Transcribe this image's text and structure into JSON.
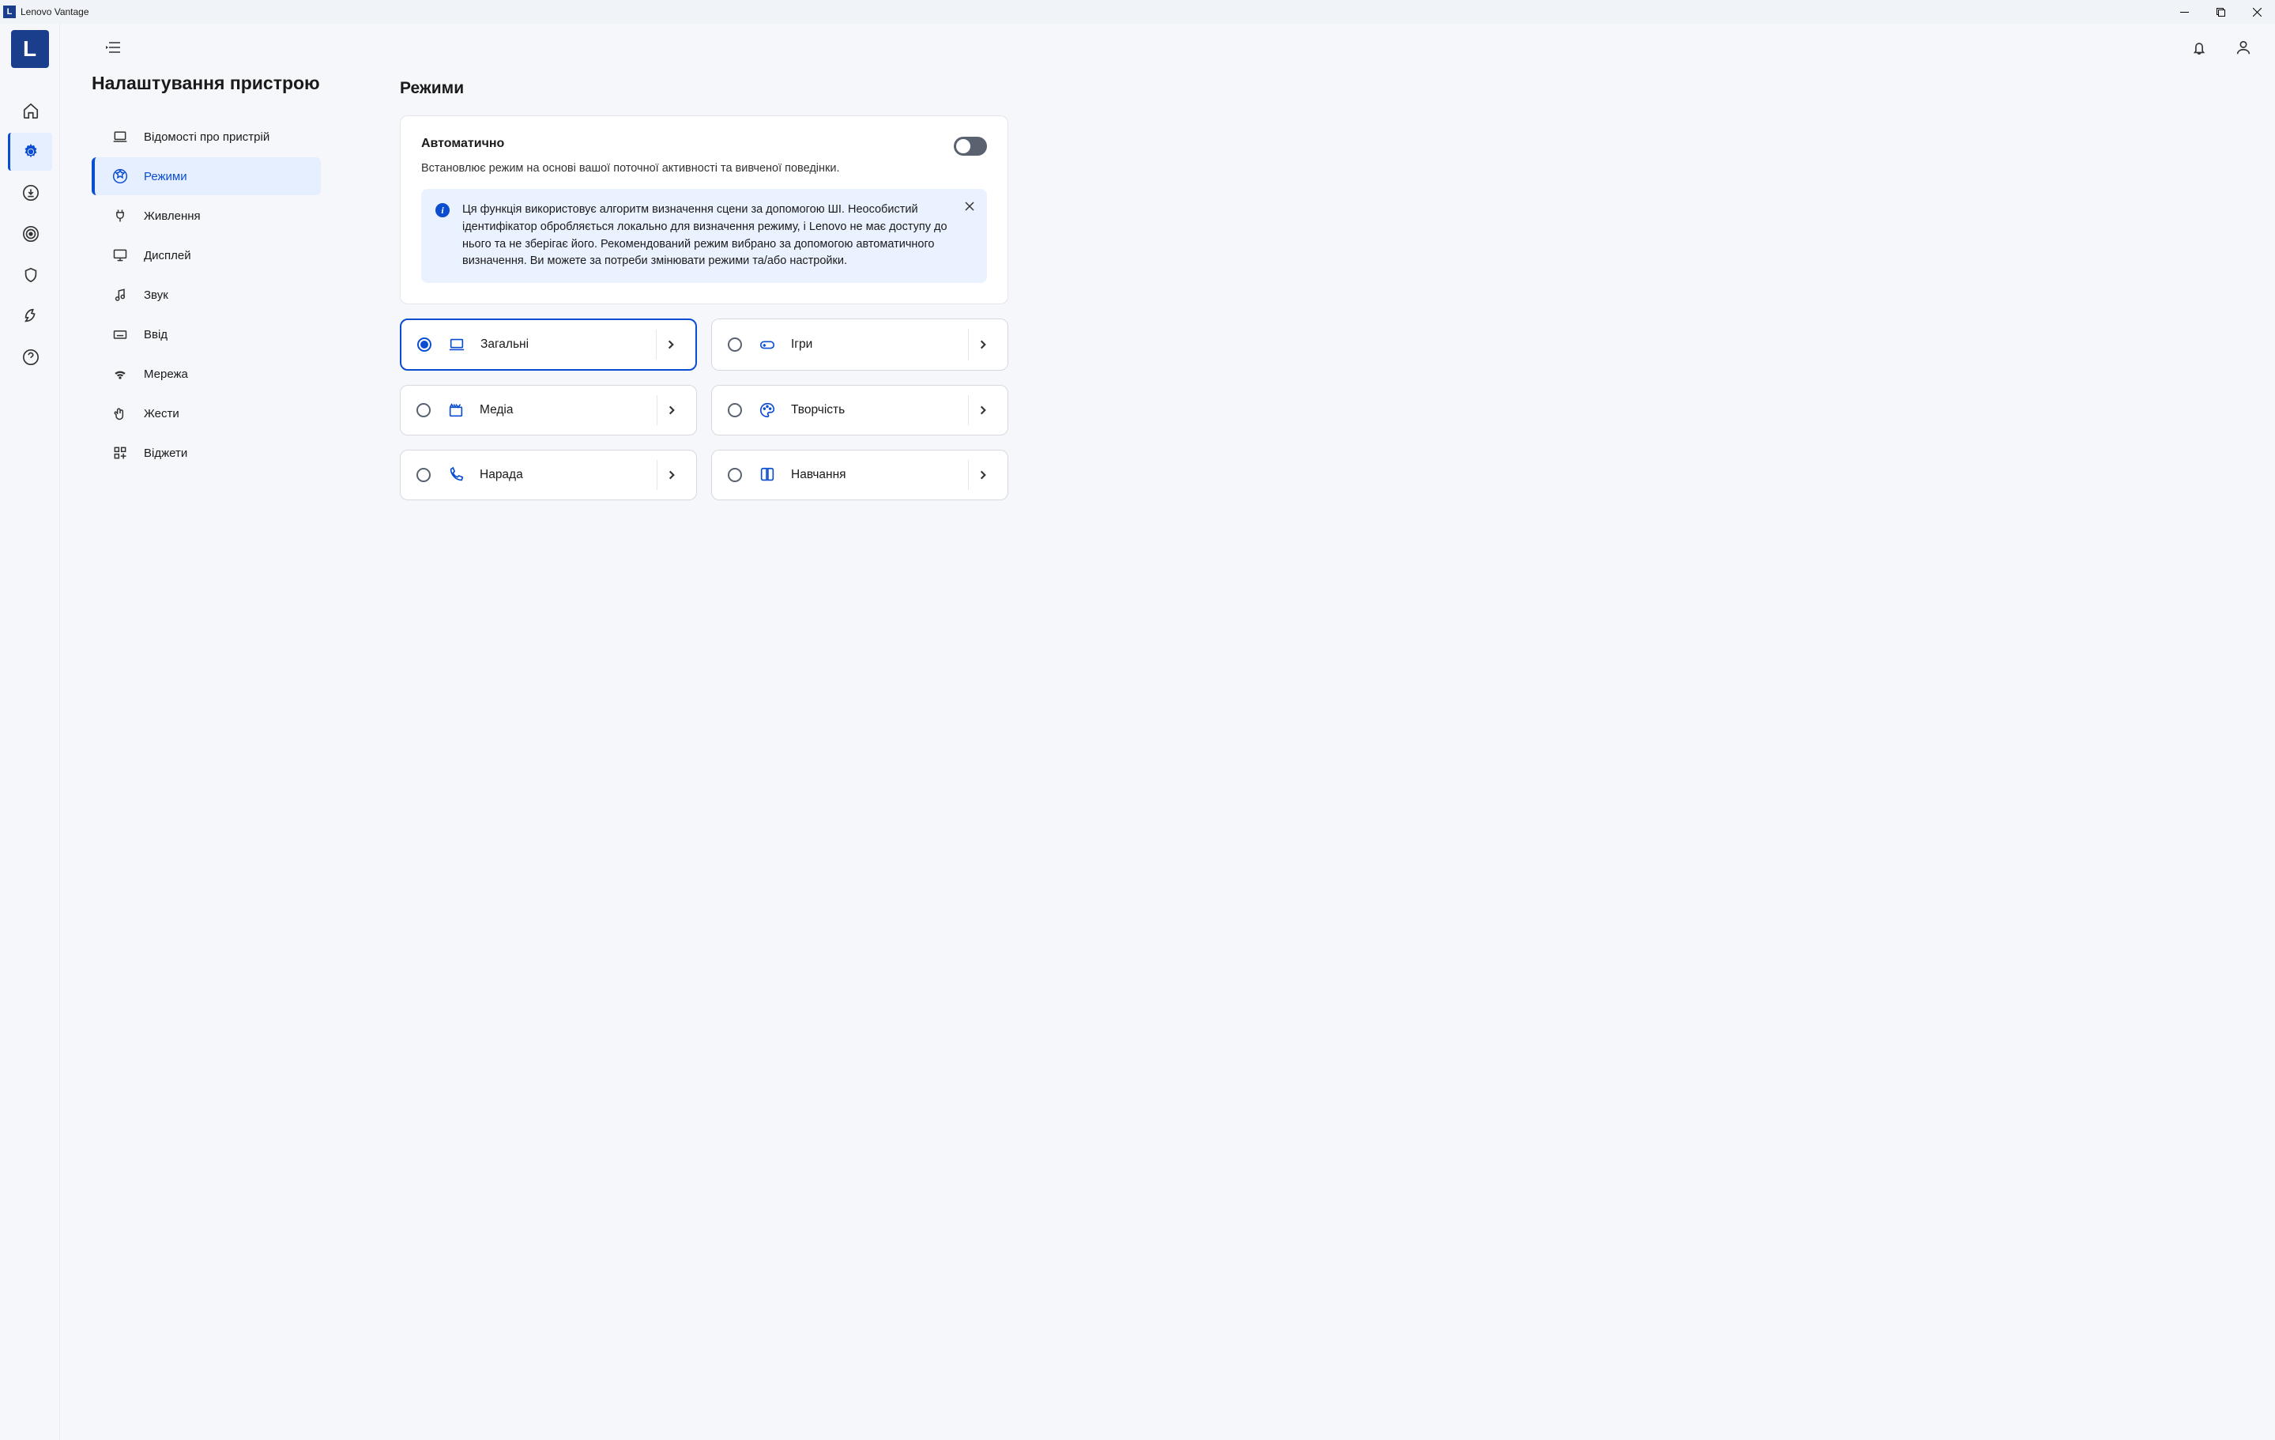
{
  "window": {
    "title": "Lenovo Vantage"
  },
  "page": {
    "title": "Налаштування пристрою"
  },
  "subnav": {
    "items": [
      {
        "label": "Відомості про пристрій"
      },
      {
        "label": "Режими"
      },
      {
        "label": "Живлення"
      },
      {
        "label": "Дисплей"
      },
      {
        "label": "Звук"
      },
      {
        "label": "Ввід"
      },
      {
        "label": "Мережа"
      },
      {
        "label": "Жести"
      },
      {
        "label": "Віджети"
      }
    ]
  },
  "section": {
    "title": "Режими"
  },
  "auto": {
    "title": "Автоматично",
    "desc": "Встановлює режим на основі вашої поточної активності та вивченої поведінки.",
    "enabled": false
  },
  "info": {
    "text": "Ця функція використовує алгоритм визначення сцени за допомогою ШІ. Неособистий ідентифікатор обробляється локально для визначення режиму, і Lenovo не має доступу до нього та не зберігає його. Рекомендований режим вибрано за допомогою автоматичного визначення. Ви можете за потреби змінювати режими та/або настройки."
  },
  "modes": [
    {
      "label": "Загальні",
      "selected": true,
      "icon": "laptop"
    },
    {
      "label": "Ігри",
      "selected": false,
      "icon": "gamepad"
    },
    {
      "label": "Медіа",
      "selected": false,
      "icon": "clapper"
    },
    {
      "label": "Творчість",
      "selected": false,
      "icon": "palette"
    },
    {
      "label": "Нарада",
      "selected": false,
      "icon": "phone"
    },
    {
      "label": "Навчання",
      "selected": false,
      "icon": "book"
    }
  ]
}
